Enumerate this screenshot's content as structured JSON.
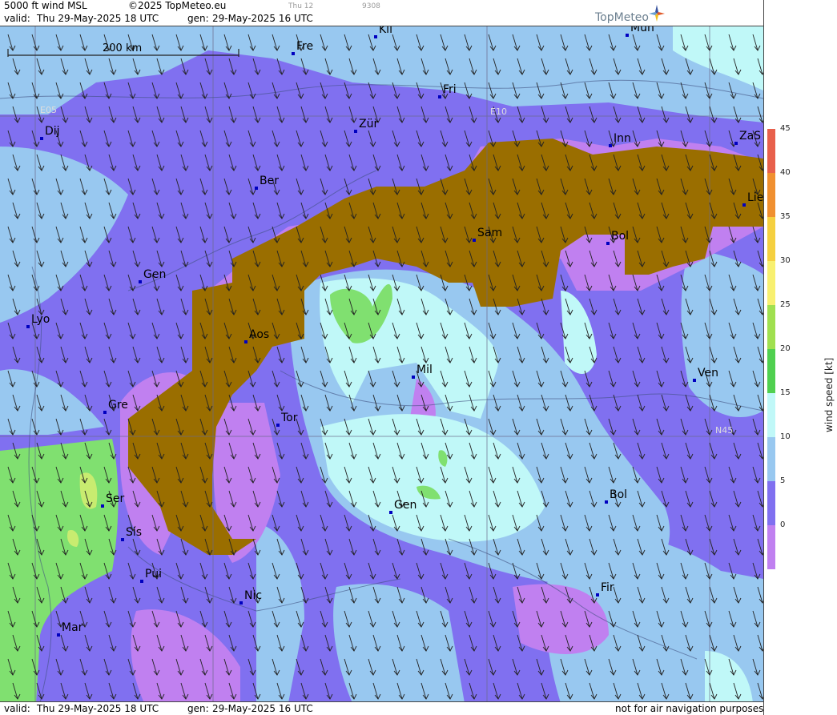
{
  "header": {
    "product": "5000 ft wind MSL",
    "copyright": "©2025 TopMeteo.eu",
    "small_a": "Thu 12",
    "small_b": "9308",
    "valid_label": "valid:",
    "valid": "Thu  29-May-2025  18 UTC",
    "gen_label": "gen:",
    "gen": "29-May-2025 16 UTC",
    "logo": "TopMeteo"
  },
  "footer": {
    "valid_label": "valid:",
    "valid": "Thu  29-May-2025  18 UTC",
    "gen_label": "gen:",
    "gen": "29-May-2025 16 UTC",
    "disclaimer": "not for air navigation purposes"
  },
  "scale_label": "200 km",
  "grid_labels": {
    "e05": "E05",
    "e10": "E10",
    "n45": "N45"
  },
  "legend": {
    "title": "wind speed [kt]",
    "ticks": [
      "45",
      "40",
      "35",
      "30",
      "25",
      "20",
      "15",
      "10",
      "5",
      "0"
    ],
    "colors": [
      "#e8604c",
      "#f09030",
      "#f5d040",
      "#f8f070",
      "#a0e050",
      "#50d050",
      "#c0f8f8",
      "#98c8f0",
      "#8070f0",
      "#c080f0"
    ]
  },
  "colors": {
    "terrain": "#9a6e00",
    "band_0_5": "#c080f0",
    "band_5_10": "#8070f0",
    "band_10_15": "#98c8f0",
    "band_15_20": "#c0f8f8",
    "band_20_25": "#80e070",
    "band_25_30": "#c8ec70"
  },
  "cities": [
    {
      "name": "Kli"
    },
    {
      "name": "Mun"
    },
    {
      "name": "Fre"
    },
    {
      "name": "Fri"
    },
    {
      "name": "Dij"
    },
    {
      "name": "Zür"
    },
    {
      "name": "Inn"
    },
    {
      "name": "ZaS"
    },
    {
      "name": "Ber"
    },
    {
      "name": "Lie"
    },
    {
      "name": "Sam"
    },
    {
      "name": "Bol"
    },
    {
      "name": "Gen"
    },
    {
      "name": "Lyo"
    },
    {
      "name": "Aos"
    },
    {
      "name": "Mil"
    },
    {
      "name": "Ven"
    },
    {
      "name": "Gre"
    },
    {
      "name": "Tor"
    },
    {
      "name": "Ser"
    },
    {
      "name": "Gen"
    },
    {
      "name": "Bol"
    },
    {
      "name": "Sis"
    },
    {
      "name": "Pui"
    },
    {
      "name": "Nic"
    },
    {
      "name": "Fir"
    },
    {
      "name": "Mar"
    }
  ]
}
